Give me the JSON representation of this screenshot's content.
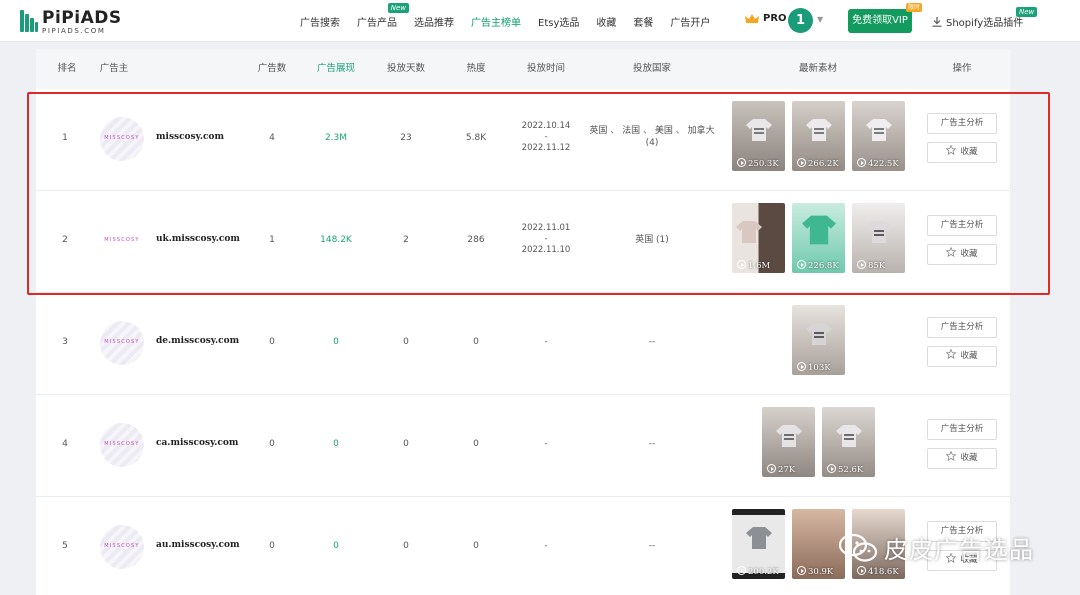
{
  "logo": {
    "name": "PiPiADS",
    "sub": "PIPIADS.COM"
  },
  "nav": [
    {
      "label": "广告搜索",
      "active": false,
      "new": false
    },
    {
      "label": "广告产品",
      "active": false,
      "new": true
    },
    {
      "label": "选品推荐",
      "active": false,
      "new": false
    },
    {
      "label": "广告主榜单",
      "active": true,
      "new": false
    },
    {
      "label": "Etsy选品",
      "active": false,
      "new": false
    },
    {
      "label": "收藏",
      "active": false,
      "new": false
    },
    {
      "label": "套餐",
      "active": false,
      "new": false
    },
    {
      "label": "广告开户",
      "active": false,
      "new": false
    }
  ],
  "new_label": "New",
  "pro_label": "PRO",
  "avatar_initial": "1",
  "vip_button": "免费领取VIP",
  "vip_tag": "限时",
  "plugin_label": "Shopify选品插件",
  "plugin_new": "New",
  "headers": {
    "rank": "排名",
    "advertiser": "广告主",
    "ad_count": "广告数",
    "impressions": "广告展现",
    "days": "投放天数",
    "heat": "热度",
    "period": "投放时间",
    "countries": "投放国家",
    "creatives": "最新素材",
    "actions": "操作"
  },
  "row_actions": {
    "analyze": "广告主分析",
    "favorite": "收藏"
  },
  "brand_logo_text": "MISSCOSY",
  "rows": [
    {
      "rank": "1",
      "domain": "misscosy.com",
      "ads": "4",
      "impressions": "2.3M",
      "days": "23",
      "heat": "5.8K",
      "date_start": "2022.10.14",
      "date_sep": "-",
      "date_end": "2022.11.12",
      "countries": "英国 、 法国 、 美国 、 加拿大 (4)",
      "views": [
        "250.3K",
        "266.2K",
        "422.5K"
      ]
    },
    {
      "rank": "2",
      "domain": "uk.misscosy.com",
      "ads": "1",
      "impressions": "148.2K",
      "days": "2",
      "heat": "286",
      "date_start": "2022.11.01",
      "date_sep": "-",
      "date_end": "2022.11.10",
      "countries": "英国 (1)",
      "views": [
        "1.6M",
        "226.8K",
        "85K"
      ]
    },
    {
      "rank": "3",
      "domain": "de.misscosy.com",
      "ads": "0",
      "impressions": "0",
      "days": "0",
      "heat": "0",
      "date_single": "-",
      "countries": "--",
      "views": [
        "103K"
      ]
    },
    {
      "rank": "4",
      "domain": "ca.misscosy.com",
      "ads": "0",
      "impressions": "0",
      "days": "0",
      "heat": "0",
      "date_single": "-",
      "countries": "--",
      "views": [
        "27K",
        "52.6K"
      ]
    },
    {
      "rank": "5",
      "domain": "au.misscosy.com",
      "ads": "0",
      "impressions": "0",
      "days": "0",
      "heat": "0",
      "date_single": "-",
      "countries": "--",
      "views": [
        "200.2K",
        "30.9K",
        "418.6K"
      ]
    }
  ],
  "watermark": "皮皮广告选品",
  "colors": {
    "accent": "#1aa37a",
    "vip": "#139a5f",
    "highlight": "#e02a2a"
  }
}
